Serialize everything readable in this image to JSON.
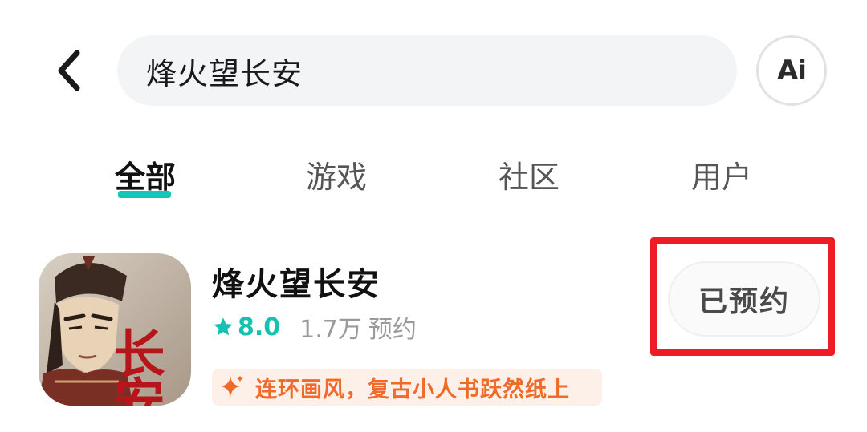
{
  "header": {
    "search_query": "烽火望长安",
    "ai_label": "Ai"
  },
  "tabs": [
    {
      "label": "全部",
      "active": true
    },
    {
      "label": "游戏",
      "active": false
    },
    {
      "label": "社区",
      "active": false
    },
    {
      "label": "用户",
      "active": false
    }
  ],
  "result": {
    "title": "烽火望长安",
    "icon_text": "长安",
    "rating": "8.0",
    "reserve_count": "1.7万",
    "reserve_label": "预约",
    "tagline": "连环画风，复古小人书跃然纸上",
    "action_label": "已预约"
  },
  "colors": {
    "accent": "#18c6b6",
    "rating": "#15c2b1",
    "tagline_text": "#f06a2a",
    "tagline_bg": "#fdf0e8",
    "highlight": "#ee1c25"
  },
  "icons": {
    "back": "chevron-left-icon",
    "star": "star-icon",
    "sparkle": "sparkle-icon"
  }
}
